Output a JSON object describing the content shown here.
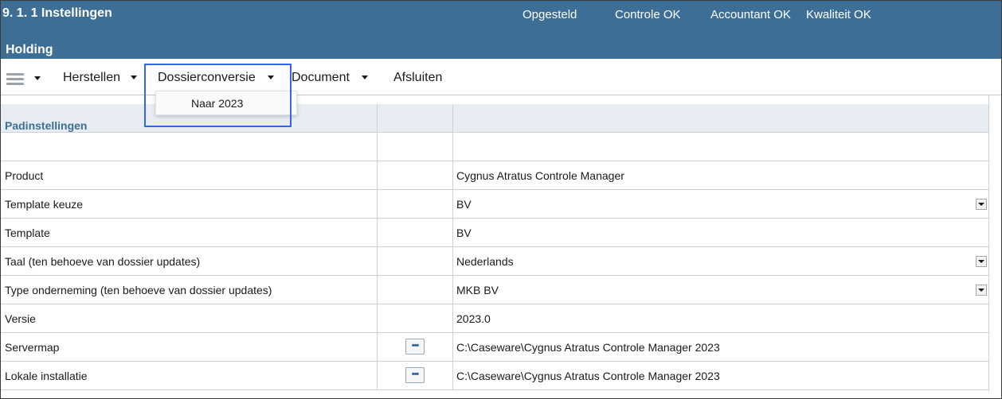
{
  "header": {
    "title": "9. 1.  1 Instellingen",
    "subtitle": "Holding",
    "statuses": [
      "Opgesteld",
      "Controle OK",
      "Accountant OK",
      "Kwaliteit OK"
    ]
  },
  "toolbar": {
    "menus": [
      "Herstellen",
      "Dossierconversie",
      "Document",
      "Afsluiten"
    ]
  },
  "dropdown": {
    "items": [
      "Naar 2023"
    ]
  },
  "table": {
    "section_label": "Padinstellingen",
    "rows": [
      {
        "label": "",
        "value": ""
      },
      {
        "label": "Product",
        "value": "Cygnus Atratus Controle Manager"
      },
      {
        "label": "Template keuze",
        "value": "BV"
      },
      {
        "label": "Template",
        "value": "BV"
      },
      {
        "label": "Taal (ten behoeve van dossier updates)",
        "value": "Nederlands"
      },
      {
        "label": "Type onderneming (ten behoeve van dossier updates)",
        "value": "MKB BV"
      },
      {
        "label": "Versie",
        "value": "2023.0"
      },
      {
        "label": "Servermap",
        "value": "C:\\Caseware\\Cygnus Atratus Controle Manager 2023"
      },
      {
        "label": "Lokale installatie",
        "value": "C:\\Caseware\\Cygnus Atratus Controle Manager 2023"
      }
    ],
    "browse_button": "•••"
  },
  "colors": {
    "header_bg": "#3d6f96",
    "section_bg": "#e7edf3",
    "highlight": "#3366ee"
  }
}
